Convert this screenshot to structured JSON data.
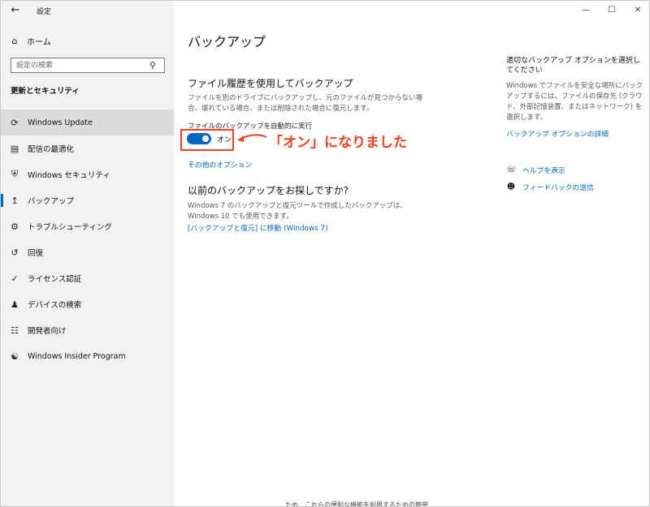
{
  "app": {
    "title": "設定"
  },
  "sidebar": {
    "home_label": "ホーム",
    "search_placeholder": "設定の検索",
    "section_title": "更新とセキュリティ",
    "items": [
      {
        "label": "Windows Update",
        "icon": "sync-icon"
      },
      {
        "label": "配信の最適化",
        "icon": "delivery-icon"
      },
      {
        "label": "Windows セキュリティ",
        "icon": "shield-icon"
      },
      {
        "label": "バックアップ",
        "icon": "backup-icon"
      },
      {
        "label": "トラブルシューティング",
        "icon": "wrench-icon"
      },
      {
        "label": "回復",
        "icon": "recovery-icon"
      },
      {
        "label": "ライセンス認証",
        "icon": "check-circle-icon"
      },
      {
        "label": "デバイスの検索",
        "icon": "person-location-icon"
      },
      {
        "label": "開発者向け",
        "icon": "sliders-icon"
      },
      {
        "label": "Windows Insider Program",
        "icon": "insider-icon"
      }
    ]
  },
  "main": {
    "page_title": "バックアップ",
    "file_history": {
      "heading": "ファイル履歴を使用してバックアップ",
      "description": "ファイルを別のドライブにバックアップし、元のファイルが見つからない場合、壊れている場合、または削除された場合に復元します。",
      "auto_label": "ファイルのバックアップを自動的に実行",
      "toggle_state": "オン",
      "more_options": "その他のオプション"
    },
    "older_backup": {
      "heading": "以前のバックアップをお探しですか?",
      "description": "Windows 7 のバックアップと復元ツールで作成したバックアップは、Windows 10 でも使用できます。",
      "link": "[バックアップと復元] に移動 (Windows 7)"
    },
    "annotation": "「オン」になりました"
  },
  "right_panel": {
    "heading": "適切なバックアップ オプションを選択してください",
    "description": "Windows でファイルを安全な場所にバックアップするには、ファイルの保存先 (クラウド、外部記憶装置、またはネットワーク) を選択します。",
    "details_link": "バックアップ オプションの詳細",
    "help_label": "ヘルプを表示",
    "feedback_label": "フィードバックの送信"
  },
  "peek_text": "ため、これらの便利な機能を利用するための簡単"
}
